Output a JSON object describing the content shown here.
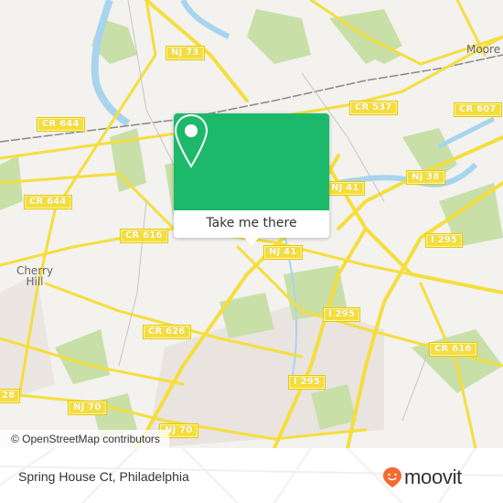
{
  "map": {
    "attribution": "© OpenStreetMap contributors",
    "road_labels": [
      {
        "id": "nj73",
        "text": "NJ 73"
      },
      {
        "id": "cr644a",
        "text": "CR 644"
      },
      {
        "id": "cr644b",
        "text": "CR 644"
      },
      {
        "id": "cr537",
        "text": "CR 537"
      },
      {
        "id": "cr607",
        "text": "CR 607"
      },
      {
        "id": "nj38",
        "text": "NJ 38"
      },
      {
        "id": "nj41a",
        "text": "NJ 41"
      },
      {
        "id": "nj41b",
        "text": "NJ 41"
      },
      {
        "id": "cr616a",
        "text": "CR 616"
      },
      {
        "id": "i295a",
        "text": "I 295"
      },
      {
        "id": "i295b",
        "text": "I 295"
      },
      {
        "id": "i295c",
        "text": "I 295"
      },
      {
        "id": "cr616b",
        "text": "CR 616"
      },
      {
        "id": "cr626",
        "text": "CR 626"
      },
      {
        "id": "cr28",
        "text": "28"
      },
      {
        "id": "nj70a",
        "text": "NJ 70"
      },
      {
        "id": "nj70b",
        "text": "NJ 70"
      }
    ],
    "places": {
      "cherry_hill": "Cherry Hill",
      "moorestown": "Moore"
    },
    "colors": {
      "background": "#f3f2ef",
      "road": "#f5de3c",
      "park": "#c8e0a8",
      "water": "#a8d4ee",
      "popup": "#1db96a"
    }
  },
  "popup": {
    "icon": "map-pin-icon",
    "action_label": "Take me there"
  },
  "footer": {
    "address": "Spring House Ct, Philadelphia",
    "brand": "moovit",
    "brand_color": "#f26a31"
  }
}
